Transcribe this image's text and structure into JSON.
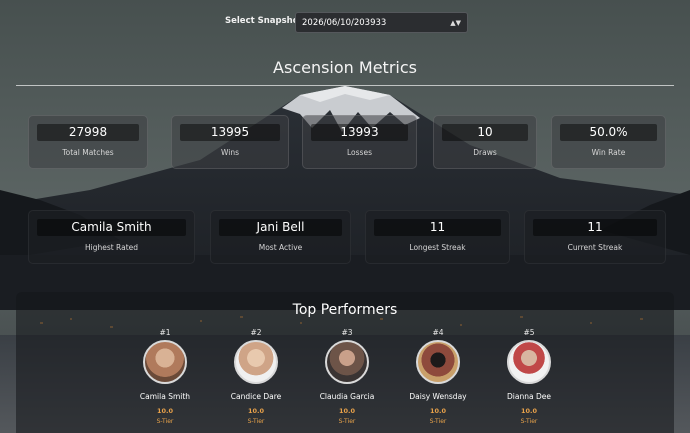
{
  "snapshot": {
    "label": "Select Snapshot:",
    "selected": "2026/06/10/203933"
  },
  "page_title": "Ascension Metrics",
  "summary_stats": [
    {
      "value": "27998",
      "label": "Total Matches"
    },
    {
      "value": "13995",
      "label": "Wins"
    },
    {
      "value": "13993",
      "label": "Losses"
    },
    {
      "value": "10",
      "label": "Draws"
    },
    {
      "value": "50.0%",
      "label": "Win Rate"
    }
  ],
  "highlight_stats": [
    {
      "value": "Camila Smith",
      "label": "Highest Rated"
    },
    {
      "value": "Jani Bell",
      "label": "Most Active"
    },
    {
      "value": "11",
      "label": "Longest Streak"
    },
    {
      "value": "11",
      "label": "Current Streak"
    }
  ],
  "top_performers": {
    "title": "Top Performers",
    "items": [
      {
        "rank": "#1",
        "name": "Camila Smith",
        "rating": "10.0",
        "tier": "S-Tier",
        "avatar_color": "#b07a5c"
      },
      {
        "rank": "#2",
        "name": "Candice Dare",
        "rating": "10.0",
        "tier": "S-Tier",
        "avatar_color": "#cfa487"
      },
      {
        "rank": "#3",
        "name": "Claudia Garcia",
        "rating": "10.0",
        "tier": "S-Tier",
        "avatar_color": "#6d5448"
      },
      {
        "rank": "#4",
        "name": "Daisy Wensday",
        "rating": "10.0",
        "tier": "S-Tier",
        "avatar_color": "#8e4a3c"
      },
      {
        "rank": "#5",
        "name": "Dianna Dee",
        "rating": "10.0",
        "tier": "S-Tier",
        "avatar_color": "#c04848"
      }
    ]
  },
  "colors": {
    "accent_rating": "#e8a24a",
    "card_bg": "#3c3e42",
    "dark_card_bg": "#1c1e22"
  }
}
